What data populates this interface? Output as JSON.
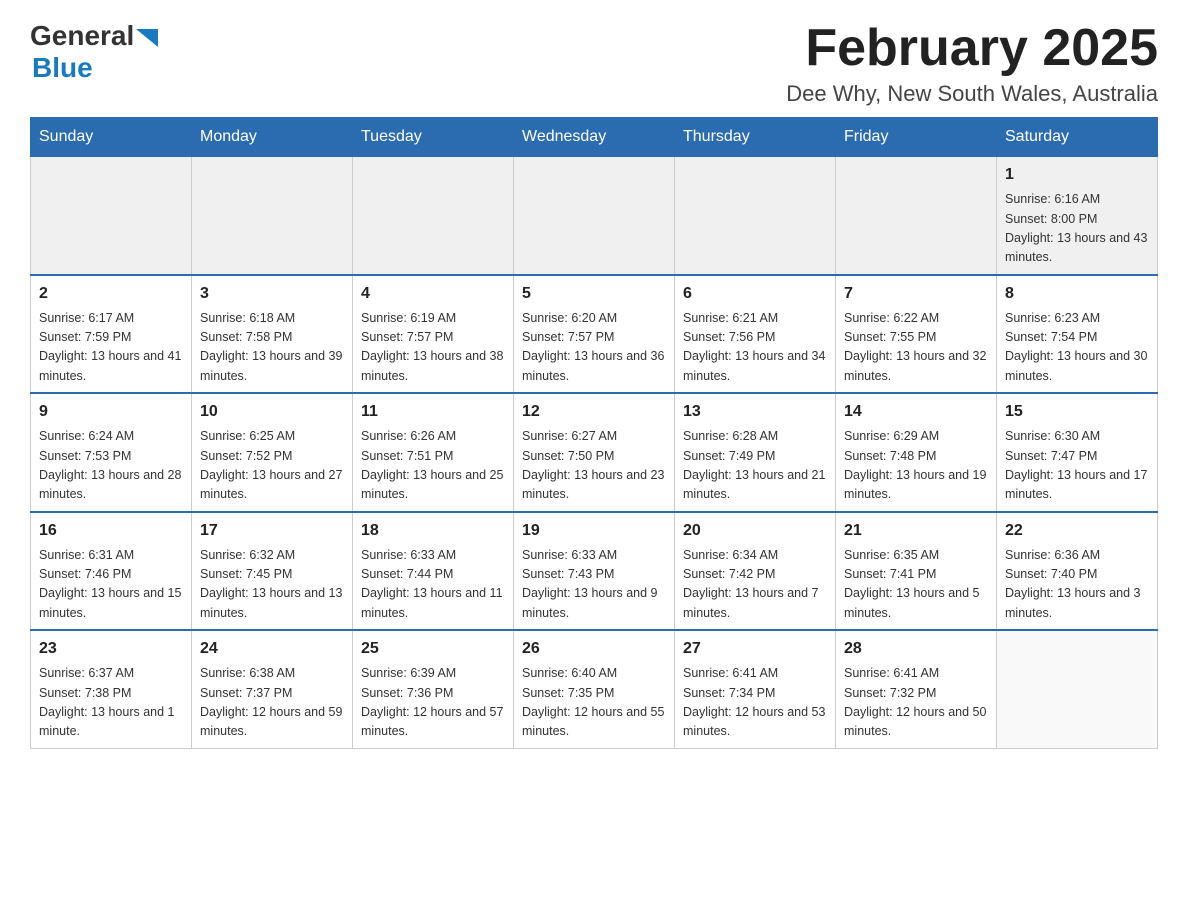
{
  "header": {
    "logo": {
      "line1": "General",
      "arrow": "▶",
      "line2": "Blue"
    },
    "title": "February 2025",
    "location": "Dee Why, New South Wales, Australia"
  },
  "days_of_week": [
    "Sunday",
    "Monday",
    "Tuesday",
    "Wednesday",
    "Thursday",
    "Friday",
    "Saturday"
  ],
  "weeks": [
    [
      {
        "day": "",
        "info": ""
      },
      {
        "day": "",
        "info": ""
      },
      {
        "day": "",
        "info": ""
      },
      {
        "day": "",
        "info": ""
      },
      {
        "day": "",
        "info": ""
      },
      {
        "day": "",
        "info": ""
      },
      {
        "day": "1",
        "info": "Sunrise: 6:16 AM\nSunset: 8:00 PM\nDaylight: 13 hours and 43 minutes."
      }
    ],
    [
      {
        "day": "2",
        "info": "Sunrise: 6:17 AM\nSunset: 7:59 PM\nDaylight: 13 hours and 41 minutes."
      },
      {
        "day": "3",
        "info": "Sunrise: 6:18 AM\nSunset: 7:58 PM\nDaylight: 13 hours and 39 minutes."
      },
      {
        "day": "4",
        "info": "Sunrise: 6:19 AM\nSunset: 7:57 PM\nDaylight: 13 hours and 38 minutes."
      },
      {
        "day": "5",
        "info": "Sunrise: 6:20 AM\nSunset: 7:57 PM\nDaylight: 13 hours and 36 minutes."
      },
      {
        "day": "6",
        "info": "Sunrise: 6:21 AM\nSunset: 7:56 PM\nDaylight: 13 hours and 34 minutes."
      },
      {
        "day": "7",
        "info": "Sunrise: 6:22 AM\nSunset: 7:55 PM\nDaylight: 13 hours and 32 minutes."
      },
      {
        "day": "8",
        "info": "Sunrise: 6:23 AM\nSunset: 7:54 PM\nDaylight: 13 hours and 30 minutes."
      }
    ],
    [
      {
        "day": "9",
        "info": "Sunrise: 6:24 AM\nSunset: 7:53 PM\nDaylight: 13 hours and 28 minutes."
      },
      {
        "day": "10",
        "info": "Sunrise: 6:25 AM\nSunset: 7:52 PM\nDaylight: 13 hours and 27 minutes."
      },
      {
        "day": "11",
        "info": "Sunrise: 6:26 AM\nSunset: 7:51 PM\nDaylight: 13 hours and 25 minutes."
      },
      {
        "day": "12",
        "info": "Sunrise: 6:27 AM\nSunset: 7:50 PM\nDaylight: 13 hours and 23 minutes."
      },
      {
        "day": "13",
        "info": "Sunrise: 6:28 AM\nSunset: 7:49 PM\nDaylight: 13 hours and 21 minutes."
      },
      {
        "day": "14",
        "info": "Sunrise: 6:29 AM\nSunset: 7:48 PM\nDaylight: 13 hours and 19 minutes."
      },
      {
        "day": "15",
        "info": "Sunrise: 6:30 AM\nSunset: 7:47 PM\nDaylight: 13 hours and 17 minutes."
      }
    ],
    [
      {
        "day": "16",
        "info": "Sunrise: 6:31 AM\nSunset: 7:46 PM\nDaylight: 13 hours and 15 minutes."
      },
      {
        "day": "17",
        "info": "Sunrise: 6:32 AM\nSunset: 7:45 PM\nDaylight: 13 hours and 13 minutes."
      },
      {
        "day": "18",
        "info": "Sunrise: 6:33 AM\nSunset: 7:44 PM\nDaylight: 13 hours and 11 minutes."
      },
      {
        "day": "19",
        "info": "Sunrise: 6:33 AM\nSunset: 7:43 PM\nDaylight: 13 hours and 9 minutes."
      },
      {
        "day": "20",
        "info": "Sunrise: 6:34 AM\nSunset: 7:42 PM\nDaylight: 13 hours and 7 minutes."
      },
      {
        "day": "21",
        "info": "Sunrise: 6:35 AM\nSunset: 7:41 PM\nDaylight: 13 hours and 5 minutes."
      },
      {
        "day": "22",
        "info": "Sunrise: 6:36 AM\nSunset: 7:40 PM\nDaylight: 13 hours and 3 minutes."
      }
    ],
    [
      {
        "day": "23",
        "info": "Sunrise: 6:37 AM\nSunset: 7:38 PM\nDaylight: 13 hours and 1 minute."
      },
      {
        "day": "24",
        "info": "Sunrise: 6:38 AM\nSunset: 7:37 PM\nDaylight: 12 hours and 59 minutes."
      },
      {
        "day": "25",
        "info": "Sunrise: 6:39 AM\nSunset: 7:36 PM\nDaylight: 12 hours and 57 minutes."
      },
      {
        "day": "26",
        "info": "Sunrise: 6:40 AM\nSunset: 7:35 PM\nDaylight: 12 hours and 55 minutes."
      },
      {
        "day": "27",
        "info": "Sunrise: 6:41 AM\nSunset: 7:34 PM\nDaylight: 12 hours and 53 minutes."
      },
      {
        "day": "28",
        "info": "Sunrise: 6:41 AM\nSunset: 7:32 PM\nDaylight: 12 hours and 50 minutes."
      },
      {
        "day": "",
        "info": ""
      }
    ]
  ]
}
